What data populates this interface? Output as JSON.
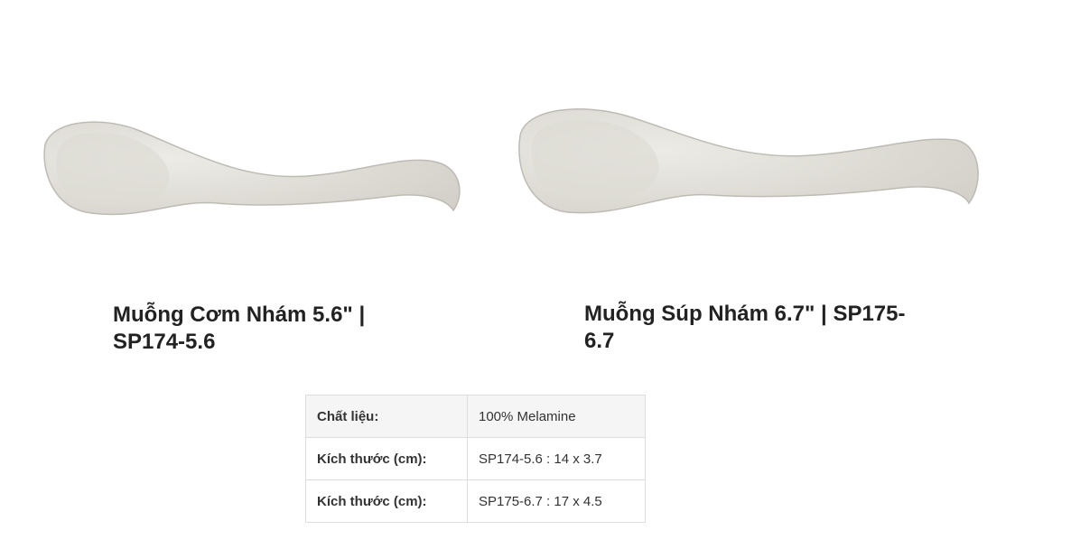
{
  "products": [
    {
      "image_icon": "rice-spoon-image",
      "title": "Muỗng Cơm Nhám 5.6\" | SP174-5.6"
    },
    {
      "image_icon": "soup-spoon-image",
      "title": "Muỗng Súp Nhám 6.7\" | SP175-6.7"
    }
  ],
  "spec_table": {
    "rows": [
      {
        "label": "Chất liệu:",
        "value": "100% Melamine"
      },
      {
        "label": "Kích thước (cm):",
        "value": "SP174-5.6 : 14 x 3.7"
      },
      {
        "label": "Kích thước (cm):",
        "value": "SP175-6.7 : 17 x 4.5"
      }
    ]
  },
  "colors": {
    "spoon_fill": "#e6e5de",
    "spoon_shadow": "#c4c2ba",
    "title_text": "#222222",
    "table_border": "#dddddd",
    "table_shaded_row": "#f5f5f5"
  }
}
